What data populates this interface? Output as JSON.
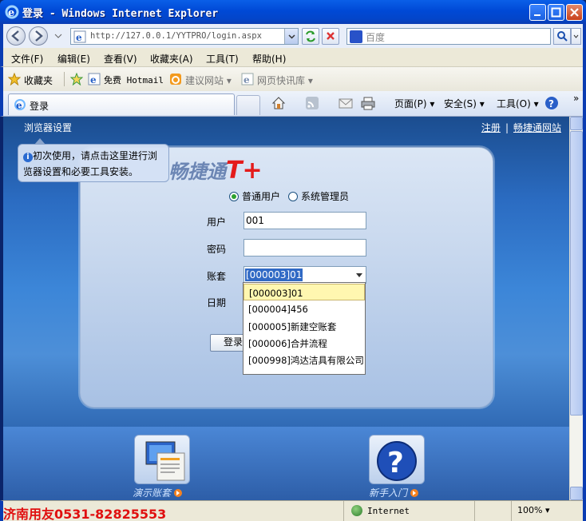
{
  "window": {
    "title": "登录 - Windows Internet Explorer"
  },
  "address_bar": {
    "url": "http://127.0.0.1/YYTPRO/login.aspx"
  },
  "search": {
    "placeholder": "百度"
  },
  "menu": {
    "items": [
      "文件(F)",
      "编辑(E)",
      "查看(V)",
      "收藏夹(A)",
      "工具(T)",
      "帮助(H)"
    ]
  },
  "favorites_bar": {
    "favorites_label": "收藏夹",
    "items": [
      "免费 Hotmail",
      "建议网站 ▾",
      "网页快讯库 ▾"
    ]
  },
  "tabs": {
    "active_tab": "登录"
  },
  "command_bar": {
    "page": "页面(P) ▾",
    "safety": "安全(S) ▾",
    "tools": "工具(O) ▾",
    "more": "»"
  },
  "page": {
    "settings_link": "浏览器设置",
    "register_link": "注册",
    "site_link": "畅捷通网站",
    "separator": "|",
    "tooltip_icon": "i",
    "tooltip_text": "初次使用，请点击这里进行浏览器设置和必要工具安装。",
    "logo_text": "畅捷通",
    "logo_mark": "T+"
  },
  "login": {
    "radio_normal": "普通用户",
    "radio_admin": "系统管理员",
    "user_label": "用户",
    "user_value": "001",
    "password_label": "密码",
    "password_value": "",
    "account_label": "账套",
    "account_selected": "[000003]01",
    "date_label": "日期",
    "login_button": "登录",
    "account_options": [
      "[000003]01",
      "[000004]456",
      "[000005]新建空账套",
      "[000006]合并流程",
      "[000998]鸿达洁具有限公司"
    ]
  },
  "tiles": {
    "demo_label": "演示账套",
    "beginner_label": "新手入门"
  },
  "status_bar": {
    "watermark": "济南用友0531-82825553",
    "zone": "Internet",
    "zoom": "100% ▾"
  },
  "colors": {
    "title_blue": "#0049d6",
    "selection_blue": "#316ac5",
    "highlight_yellow": "#fff7b0",
    "logo_red": "#e41b1b",
    "watermark_red": "#e01010"
  }
}
